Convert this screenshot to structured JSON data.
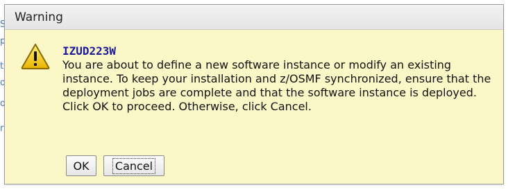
{
  "dialog": {
    "title": "Warning",
    "message_id": "IZUD223W",
    "message": "You are about to define a new software instance or modify an existing instance. To keep your installation and z/OSMF synchronized, ensure that the deployment jobs are complete and that the software instance is deployed. Click OK to proceed. Otherwise, click Cancel.",
    "icon": "warning-icon",
    "buttons": {
      "ok_label": "OK",
      "cancel_label": "Cancel"
    }
  },
  "colors": {
    "dialog_background": "#fbf7c6",
    "message_id_color": "#1a1a9a",
    "icon_fill": "#f2c200"
  }
}
